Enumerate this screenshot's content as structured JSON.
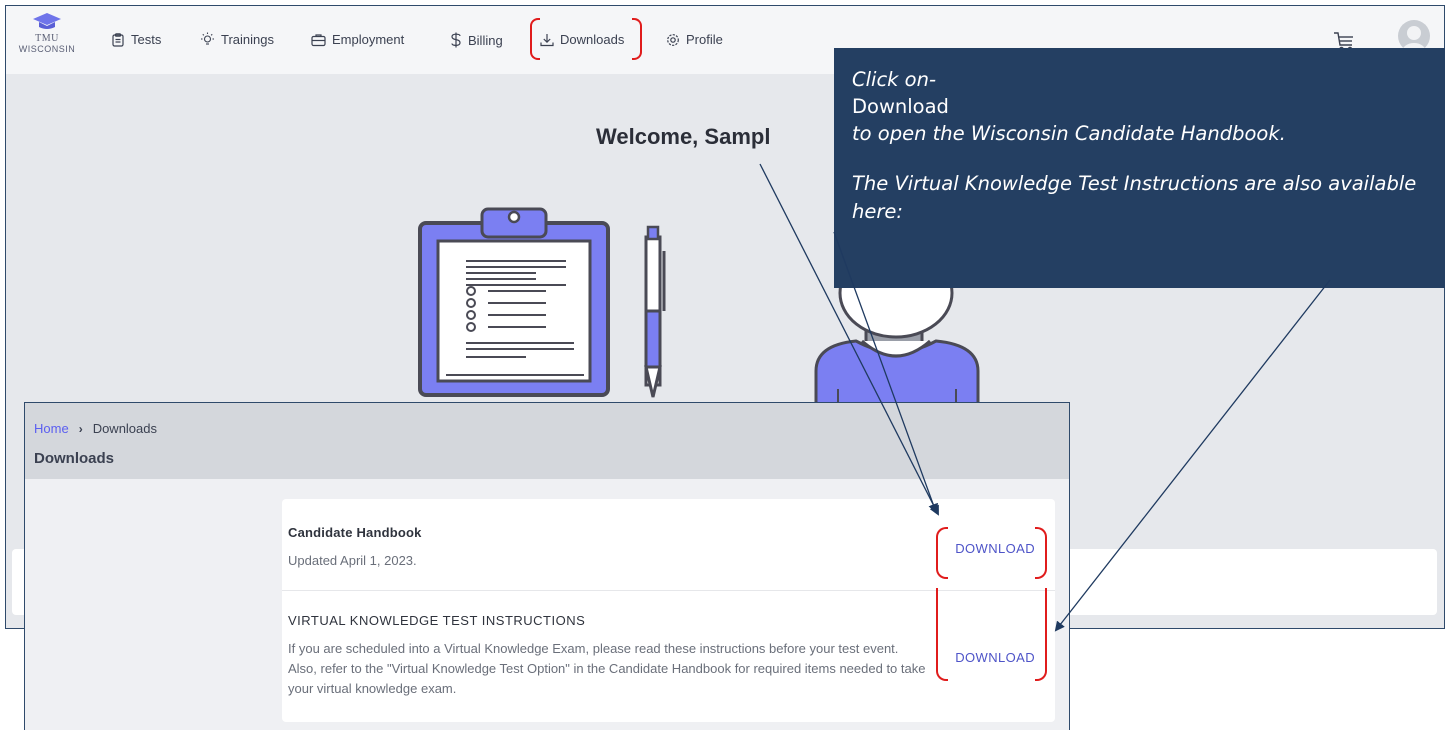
{
  "app": {
    "logo": {
      "line1": "TMU",
      "line2": "WISCONSIN"
    },
    "nav": [
      {
        "label": "Tests",
        "icon": "clipboard-icon"
      },
      {
        "label": "Trainings",
        "icon": "lightbulb-icon"
      },
      {
        "label": "Employment",
        "icon": "briefcase-icon"
      },
      {
        "label": "Billing",
        "icon": "dollar-icon"
      },
      {
        "label": "Downloads",
        "icon": "download-icon"
      },
      {
        "label": "Profile",
        "icon": "gear-icon"
      }
    ],
    "welcome": "Welcome, Sampl"
  },
  "callout": {
    "line1": "Click on-",
    "line2": "Download",
    "line3": "to open the Wisconsin Candidate Handbook.",
    "line4": "The Virtual Knowledge Test Instructions are also available here:"
  },
  "panel": {
    "breadcrumb": {
      "home": "Home",
      "current": "Downloads"
    },
    "title": "Downloads",
    "items": [
      {
        "title": "Candidate Handbook",
        "description": "Updated April 1, 2023.",
        "button": "DOWNLOAD"
      },
      {
        "title": "VIRTUAL KNOWLEDGE TEST INSTRUCTIONS",
        "description": "If you are scheduled into a Virtual Knowledge Exam, please read these instructions before your test event. Also, refer to the \"Virtual Knowledge Test Option\" in the Candidate Handbook for required items needed to take your virtual knowledge exam.",
        "button": "DOWNLOAD"
      }
    ]
  },
  "colors": {
    "callout_bg": "#243f62",
    "highlight_red": "#e01c1c",
    "accent_purple": "#4e54c8",
    "illustration_purple": "#7b7ff2"
  }
}
